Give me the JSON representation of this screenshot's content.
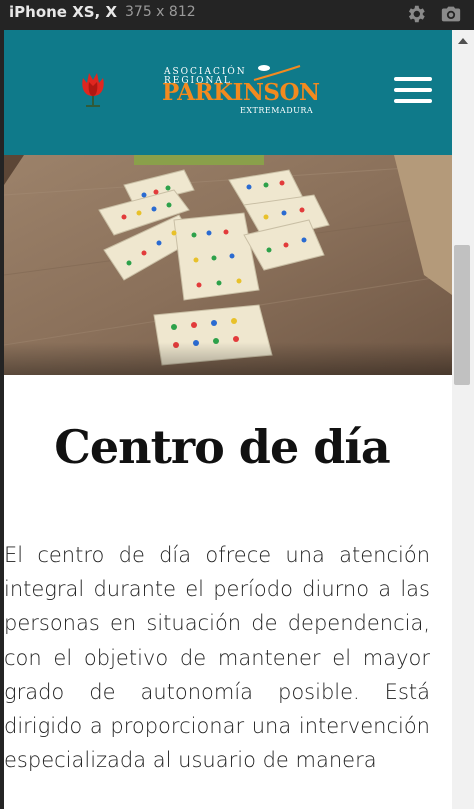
{
  "devtools": {
    "device": "iPhone XS, X",
    "dimensions": "375  x  812",
    "icons": [
      "gear-icon",
      "camera-icon"
    ]
  },
  "header": {
    "logo": {
      "line1": "ASOCIACIÓN",
      "line2": "REGIONAL",
      "line3": "PARKINSON",
      "line4": "EXTREMADURA"
    },
    "icons": [
      "tulip-icon",
      "hamburger-menu-icon"
    ]
  },
  "colors": {
    "header_bg": "#0f7a8a",
    "logo_accent": "#f28a1f"
  },
  "main": {
    "title": "Centro de día",
    "body": "El centro de día ofrece una atención integral durante el período diurno a las personas en situación de dependencia, con el objetivo de mantener el mayor grado de autonomía posible. Está dirigido a proporcionar una intervención especializada al usuario de manera"
  }
}
